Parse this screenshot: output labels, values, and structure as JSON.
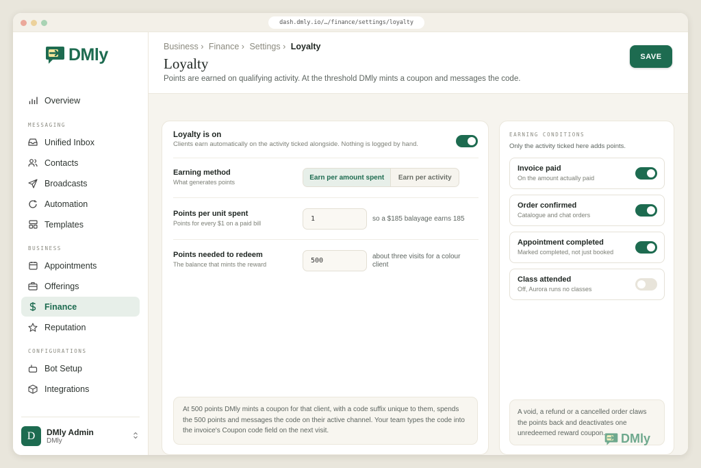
{
  "browser": {
    "url": "dash.dmly.io/…/finance/settings/loyalty"
  },
  "brand": {
    "name": "DMly",
    "accent": "#1d6b50"
  },
  "sidebar": {
    "overview": "Overview",
    "messaging_label": "MESSAGING",
    "messaging": [
      "Unified Inbox",
      "Contacts",
      "Broadcasts",
      "Automation",
      "Templates"
    ],
    "business_label": "BUSINESS",
    "business": [
      "Appointments",
      "Offerings",
      "Finance",
      "Reputation"
    ],
    "config_label": "CONFIGURATIONS",
    "config": [
      "Bot Setup",
      "Integrations"
    ],
    "active": "Finance"
  },
  "user": {
    "initial": "D",
    "name": "DMly Admin",
    "org": "DMly"
  },
  "header": {
    "crumbs": [
      "Business ›",
      "Finance ›",
      "Settings ›"
    ],
    "crumb_current": "Loyalty",
    "title": "Loyalty",
    "subtitle": "Points are earned on qualifying activity. At the threshold DMly mints a coupon and messages the code.",
    "save": "SAVE"
  },
  "loyalty": {
    "title": "Loyalty is on",
    "sub": "Clients earn automatically on the activity ticked alongside. Nothing is logged by hand.",
    "enabled": true,
    "method": {
      "title": "Earning method",
      "sub": "What generates points",
      "options": [
        "Earn per amount spent",
        "Earn per activity"
      ],
      "selected": "Earn per amount spent"
    },
    "points": {
      "title": "Points per unit spent",
      "sub": "Points for every $1 on a paid bill",
      "value": "1",
      "hint": "so a $185 balayage earns 185"
    },
    "redeem": {
      "title": "Points needed to redeem",
      "sub": "The balance that mints the reward",
      "value": "500",
      "hint": "about three visits for a colour client"
    },
    "note": "At 500 points DMly mints a coupon for that client, with a code suffix unique to them, spends the 500 points and messages the code on their active channel. Your team types the code into the invoice's Coupon code field on the next visit."
  },
  "conditions": {
    "label": "EARNING CONDITIONS",
    "sub": "Only the activity ticked here adds points.",
    "items": [
      {
        "title": "Invoice paid",
        "sub": "On the amount actually paid",
        "on": true
      },
      {
        "title": "Order confirmed",
        "sub": "Catalogue and chat orders",
        "on": true
      },
      {
        "title": "Appointment completed",
        "sub": "Marked completed, not just booked",
        "on": true
      },
      {
        "title": "Class attended",
        "sub": "Off, Aurora runs no classes",
        "on": false
      }
    ],
    "note": "A void, a refund or a cancelled order claws the points back and deactivates one unredeemed reward coupon."
  }
}
